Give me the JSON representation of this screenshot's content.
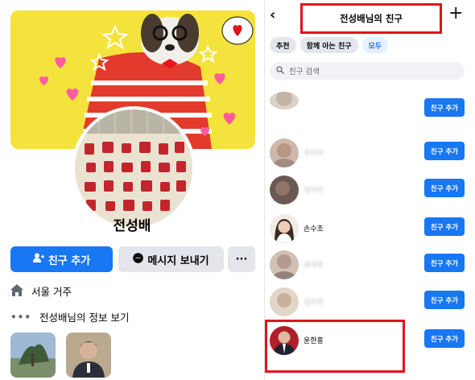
{
  "profile": {
    "name": "전성배",
    "add_friend_label": "친구 추가",
    "message_label": "메시지 보내기",
    "more_label": "···",
    "location": "서울 거주",
    "about_link": "전성배님의 정보 보기"
  },
  "friends_header": {
    "back_glyph": "‹",
    "title": "전성배님의 친구",
    "plus_glyph": "+"
  },
  "filter_chips": [
    "추천",
    "함께 아는 친구",
    "모두"
  ],
  "search": {
    "placeholder": "친구 검색"
  },
  "friends": [
    {
      "name": "",
      "blurred": true,
      "button": "친구 추가"
    },
    {
      "name": "정미라",
      "blurred": true,
      "button": "친구 추가"
    },
    {
      "name": "정미라",
      "blurred": true,
      "button": "친구 추가"
    },
    {
      "name": "노기원",
      "blurred": true,
      "button": "친구 추가"
    },
    {
      "name": "손수조",
      "blurred": false,
      "button": "친구 추가"
    },
    {
      "name": "윤태희",
      "blurred": true,
      "button": "친구 추가"
    },
    {
      "name": "김미영",
      "blurred": true,
      "button": "친구 추가"
    },
    {
      "name": "윤한홍",
      "blurred": false,
      "button": "친구 추가"
    }
  ],
  "colors": {
    "accent": "#1877f2",
    "highlight_box": "#e0141e",
    "cover_bg": "#f4e33c",
    "button_gray": "#e4e6eb"
  }
}
